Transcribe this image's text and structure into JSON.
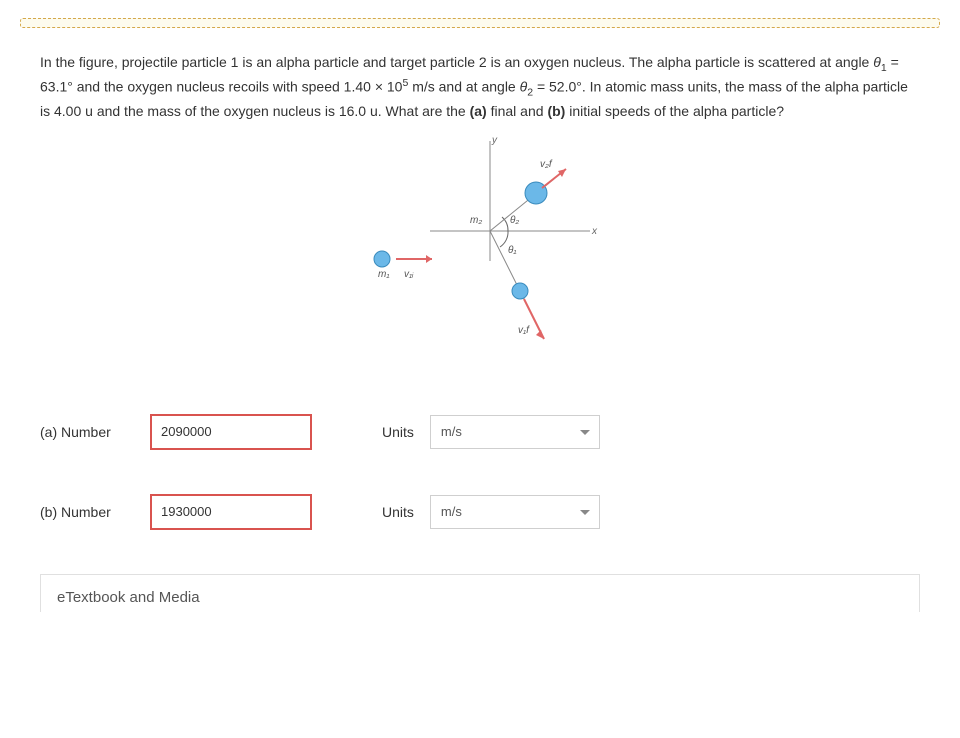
{
  "problem": {
    "text_full": "In the figure, projectile particle 1 is an alpha particle and target particle 2 is an oxygen nucleus. The alpha particle is scattered at angle θ₁ = 63.1° and the oxygen nucleus recoils with speed 1.40 × 10⁵ m/s and at angle θ₂ = 52.0°. In atomic mass units, the mass of the alpha particle is 4.00 u and the mass of the oxygen nucleus is 16.0 u. What are the (a) final and (b) initial speeds of the alpha particle?"
  },
  "figure_labels": {
    "y": "y",
    "x": "x",
    "m1": "m₁",
    "m2": "m₂",
    "v1i": "v₁ᵢ",
    "v1f": "v₁f",
    "v2f": "v₂f",
    "theta1": "θ₁",
    "theta2": "θ₂"
  },
  "answers": {
    "a": {
      "label": "(a)   Number",
      "value": "2090000",
      "units_label": "Units",
      "units_value": "m/s"
    },
    "b": {
      "label": "(b)   Number",
      "value": "1930000",
      "units_label": "Units",
      "units_value": "m/s"
    }
  },
  "footer": {
    "etextbook": "eTextbook and Media"
  }
}
